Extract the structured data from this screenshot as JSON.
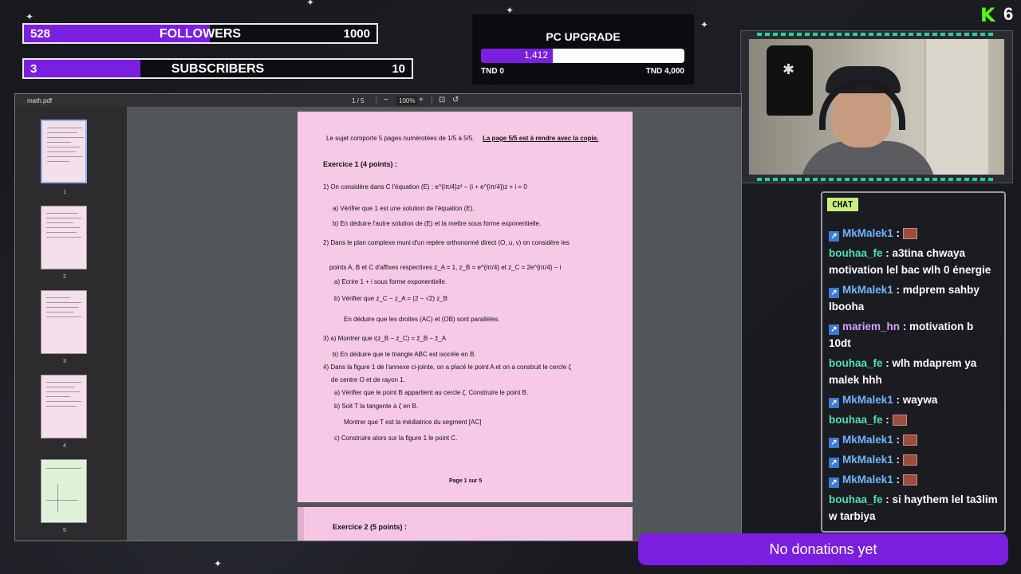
{
  "followers": {
    "current": "528",
    "label": "FOLLOWERS",
    "goal": "1000",
    "progress": 0.528
  },
  "subscribers": {
    "current": "3",
    "label": "SUBSCRIBERS",
    "goal": "10",
    "progress": 0.3
  },
  "pc_upgrade": {
    "title": "PC UPGRADE",
    "amount": "1,412",
    "min": "TND 0",
    "max": "TND 4,000",
    "progress": 0.353
  },
  "kick": {
    "logo": "K",
    "count": "6",
    "brand_color": "#53fc18"
  },
  "accent_color": "#7a1fe0",
  "pdf": {
    "filename": "math.pdf",
    "page_indicator": "1 / 5",
    "zoom": "100%",
    "thumbnails": [
      "1",
      "2",
      "3",
      "4",
      "5"
    ],
    "page1_lines": [
      {
        "text": "Le sujet comporte 5 pages numérotées de 1/5 à 5/5.",
        "bold": false
      },
      {
        "text": "La page 5/5 est à rendre avec la copie.",
        "bold": true
      },
      {
        "text": "Exercice 1 (4 points) :",
        "bold": true
      },
      {
        "text": "1) On considère dans C l'équation (E) : e^{iπ/4}z² − (i + e^{iπ/4})z + i = 0",
        "bold": false
      },
      {
        "text": "a) Vérifier que 1 est une solution de l'équation (E).",
        "bold": false
      },
      {
        "text": "b) En déduire l'autre solution de (E) et la mettre sous forme exponentielle.",
        "bold": false
      },
      {
        "text": "2) Dans le plan complexe muni d'un repère orthonormé direct (O, u, v) on considère les",
        "bold": false
      },
      {
        "text": "points A, B et C d'affixes respectives z_A = 1, z_B = e^{iπ/4} et z_C = 2e^{iπ/4} − i",
        "bold": false
      },
      {
        "text": "a) Ecrire 1 + i sous forme exponentielle.",
        "bold": false
      },
      {
        "text": "b) Vérifier que z_C − z_A = (2 − √2) z_B",
        "bold": false
      },
      {
        "text": "En déduire que les droites (AC) et (OB) sont parallèles.",
        "bold": false
      },
      {
        "text": "3) a) Montrer que i(z_B − z_C) = z̄_B − z̄_A",
        "bold": false
      },
      {
        "text": "b) En déduire que le triangle ABC est isocèle en B.",
        "bold": false
      },
      {
        "text": "4) Dans la figure 1 de l'annexe ci-jointe, on a placé le point A et on a construit le cercle ζ",
        "bold": false
      },
      {
        "text": "de centre O et de rayon 1.",
        "bold": false
      },
      {
        "text": "a) Vérifier que le point B appartient au cercle ζ. Construire le point B.",
        "bold": false
      },
      {
        "text": "b) Soit T la tangente à ζ en B.",
        "bold": false
      },
      {
        "text": "Montrer que T est la médiatrice du segment [AC]",
        "bold": false
      },
      {
        "text": "c) Construire alors sur la figure 1 le point C.",
        "bold": false
      },
      {
        "text": "Page 1 sur 5",
        "bold": true
      }
    ],
    "page2_heading": "Exercice 2 (5 points) :"
  },
  "chat": {
    "header": "CHAT",
    "messages": [
      {
        "user": "MkMalek1",
        "user_color": "#6fb6ff",
        "text": "",
        "emote": true,
        "badge": true
      },
      {
        "user": "bouhaa_fe",
        "user_color": "#4fe0b0",
        "text": "a3tina chwaya motivation lel bac wlh 0 énergie",
        "emote": false,
        "badge": false
      },
      {
        "user": "MkMalek1",
        "user_color": "#6fb6ff",
        "text": "mdprem sahby lbooha",
        "emote": false,
        "badge": true
      },
      {
        "user": "mariem_hn",
        "user_color": "#d8a0ff",
        "text": "motivation b 10dt",
        "emote": false,
        "badge": true
      },
      {
        "user": "bouhaa_fe",
        "user_color": "#4fe0b0",
        "text": "wlh mdaprem ya malek hhh",
        "emote": false,
        "badge": false
      },
      {
        "user": "MkMalek1",
        "user_color": "#6fb6ff",
        "text": "waywa",
        "emote": false,
        "badge": true
      },
      {
        "user": "bouhaa_fe",
        "user_color": "#4fe0b0",
        "text": "",
        "emote": true,
        "badge": false
      },
      {
        "user": "MkMalek1",
        "user_color": "#6fb6ff",
        "text": "",
        "emote": true,
        "badge": true
      },
      {
        "user": "MkMalek1",
        "user_color": "#6fb6ff",
        "text": "",
        "emote": true,
        "badge": true
      },
      {
        "user": "MkMalek1",
        "user_color": "#6fb6ff",
        "text": "",
        "emote": true,
        "badge": true
      },
      {
        "user": "bouhaa_fe",
        "user_color": "#4fe0b0",
        "text": "si haythem lel ta3lim w tarbiya",
        "emote": false,
        "badge": false
      }
    ]
  },
  "donations": {
    "text": "No donations yet"
  }
}
